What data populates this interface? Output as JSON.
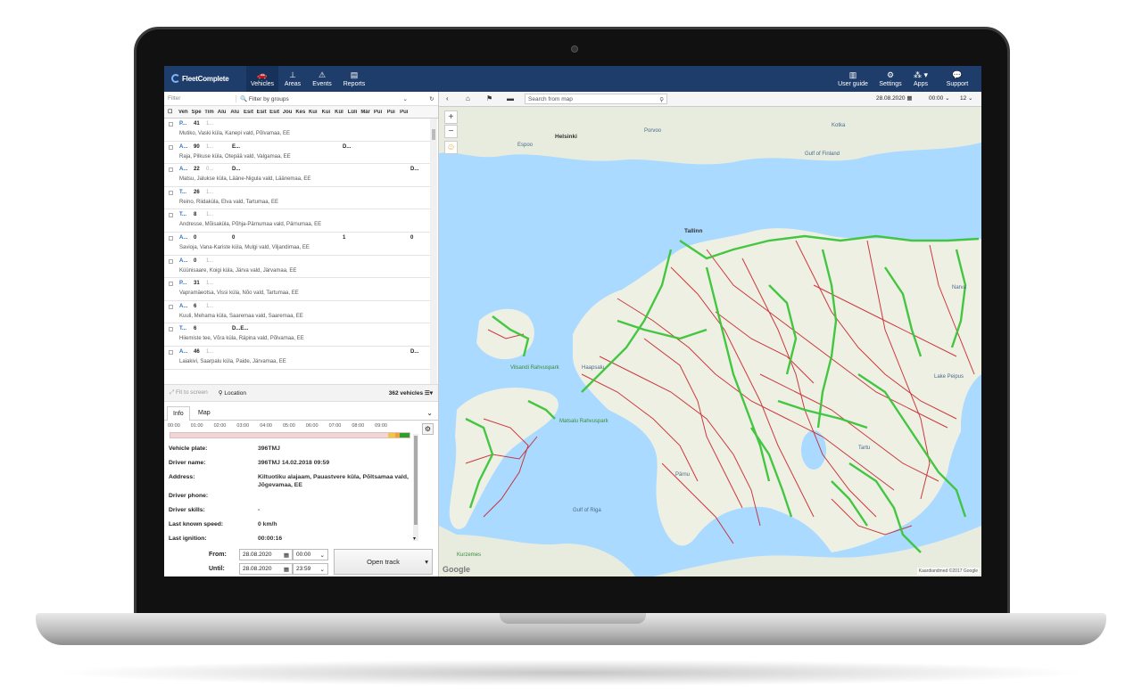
{
  "app": {
    "logo_text": "FleetComplete"
  },
  "nav": {
    "left": [
      {
        "label": "Vehicles",
        "icon": "car-icon"
      },
      {
        "label": "Areas",
        "icon": "pin-icon"
      },
      {
        "label": "Events",
        "icon": "warning-icon"
      },
      {
        "label": "Reports",
        "icon": "document-icon"
      }
    ],
    "right": [
      {
        "label": "User guide",
        "icon": "book-icon"
      },
      {
        "label": "Settings",
        "icon": "gears-icon"
      },
      {
        "label": "Apps",
        "icon": "apps-icon"
      },
      {
        "label": "Support",
        "icon": "chat-icon"
      }
    ]
  },
  "filters": {
    "filter_placeholder": "Filter",
    "groups_placeholder": "Filter by groups"
  },
  "table": {
    "headers": [
      "Veh",
      "Spe",
      "Tim",
      "Alu",
      "Alu",
      "Esit",
      "Esit",
      "Esit",
      "Jõu",
      "Kes",
      "Kui",
      "Kui",
      "Kül",
      "Lüli",
      "Mär",
      "Pui",
      "Pui",
      "Pui"
    ],
    "rows": [
      {
        "c1": "P...",
        "c2": "41",
        "c3": "1...",
        "c4": "",
        "c5": "",
        "c6": "",
        "addr": "Mutiko, Vaski küla, Kanepi vald, Põlvamaa, EE"
      },
      {
        "c1": "A...",
        "c2": "90",
        "c3": "1...",
        "c4": "E...",
        "c5": "D...",
        "c6": "",
        "addr": "Raja, Pilkuse küla, Otepää vald, Valgamaa, EE"
      },
      {
        "c1": "A...",
        "c2": "22",
        "c3": "0...",
        "c4": "D...",
        "c5": "",
        "c6": "D...",
        "addr": "Matsu, Jalukse küla, Lääne-Nigula vald, Läänemaa, EE"
      },
      {
        "c1": "T...",
        "c2": "26",
        "c3": "1...",
        "c4": "",
        "c5": "",
        "c6": "",
        "addr": "Reino, Riidaküla, Elva vald, Tartumaa, EE"
      },
      {
        "c1": "T...",
        "c2": "8",
        "c3": "1...",
        "c4": "",
        "c5": "",
        "c6": "",
        "addr": "Andresse, Mõisaküla, Põhja-Pärnumaa vald, Pärnumaa, EE"
      },
      {
        "c1": "A...",
        "c2": "0",
        "c3": "",
        "c4": "0",
        "c5": "1",
        "c6": "0",
        "addr": "Savioja, Vana-Kariste küla, Mulgi vald, Viljandimaa, EE"
      },
      {
        "c1": "A...",
        "c2": "0",
        "c3": "1...",
        "c4": "",
        "c5": "",
        "c6": "",
        "addr": "Küünisaare, Koigi küla, Järva vald, Järvamaa, EE"
      },
      {
        "c1": "P...",
        "c2": "31",
        "c3": "1...",
        "c4": "",
        "c5": "",
        "c6": "",
        "addr": "Vapramäeotsa, Vissi küla, Nõo vald, Tartumaa, EE"
      },
      {
        "c1": "A...",
        "c2": "6",
        "c3": "1...",
        "c4": "",
        "c5": "",
        "c6": "",
        "addr": "Kuuli, Mehama küla, Saaremaa vald, Saaremaa, EE"
      },
      {
        "c1": "T...",
        "c2": "6",
        "c3": "",
        "c4": "D...E...",
        "c5": "",
        "c6": "",
        "addr": "Hiiemiste tee, Võra küla, Räpina vald, Põlvamaa, EE"
      },
      {
        "c1": "A...",
        "c2": "46",
        "c3": "1...",
        "c4": "",
        "c5": "",
        "c6": "D...",
        "addr": "Laiakivi, Saarpalu küla, Paide, Järvamaa, EE"
      }
    ]
  },
  "toolbar": {
    "fit_label": "Fit to screen",
    "location_label": "Location",
    "count_label": "362 vehicles"
  },
  "detail_tabs": [
    "Info",
    "Map"
  ],
  "timeline": {
    "ticks": [
      "00:00",
      "01:00",
      "02:00",
      "03:00",
      "04:00",
      "05:00",
      "06:00",
      "07:00",
      "08:00",
      "09:00",
      ""
    ],
    "segments": [
      {
        "start": 0.91,
        "end": 0.94,
        "color": "#f4c542"
      },
      {
        "start": 0.94,
        "end": 0.96,
        "color": "#f0a23a"
      },
      {
        "start": 0.96,
        "end": 1.0,
        "color": "#2aa12a"
      }
    ]
  },
  "info": {
    "vehicle_plate_label": "Vehicle plate:",
    "vehicle_plate": "396TMJ",
    "driver_name_label": "Driver name:",
    "driver_name": "396TMJ 14.02.2018 09:59",
    "address_label": "Address:",
    "address": "Kiltuotiku alajaam, Pauastvere küla, Põltsamaa vald, Jõgevamaa, EE",
    "driver_phone_label": "Driver phone:",
    "driver_phone": "",
    "driver_skills_label": "Driver skills:",
    "driver_skills": "-",
    "speed_label": "Last known speed:",
    "speed": "0 km/h",
    "ignition_label": "Last ignition:",
    "ignition": "00:00:16"
  },
  "track": {
    "from_label": "From:",
    "from_date": "28.08.2020",
    "from_time": "00:00",
    "until_label": "Until:",
    "until_date": "28.08.2020",
    "until_time": "23:59",
    "open_button": "Open track"
  },
  "mapbar": {
    "search_placeholder": "Search from map",
    "date": "28.08.2020",
    "time": "00:00",
    "zoom": "12"
  },
  "map": {
    "labels": {
      "tallinn": "Tallinn",
      "espoo": "Espoo",
      "helsinki": "Helsinki",
      "porvoo": "Porvoo",
      "kotka": "Kotka",
      "gulf_finland": "Gulf of Finland",
      "lake_peipus": "Lake Peipus",
      "gulf_riga": "Gulf of Riga",
      "vilsandi": "Vilsandi Rahvuspark",
      "matsalu": "Matsalu Rahvuspark",
      "kurzemes": "Kurzemes",
      "haapsalu": "Haapsalu",
      "parnu": "Pärnu",
      "tartu": "Tartu",
      "narva": "Narva"
    },
    "google_logo": "Google",
    "attribution": "Kaardiandmed ©2017 Google"
  }
}
